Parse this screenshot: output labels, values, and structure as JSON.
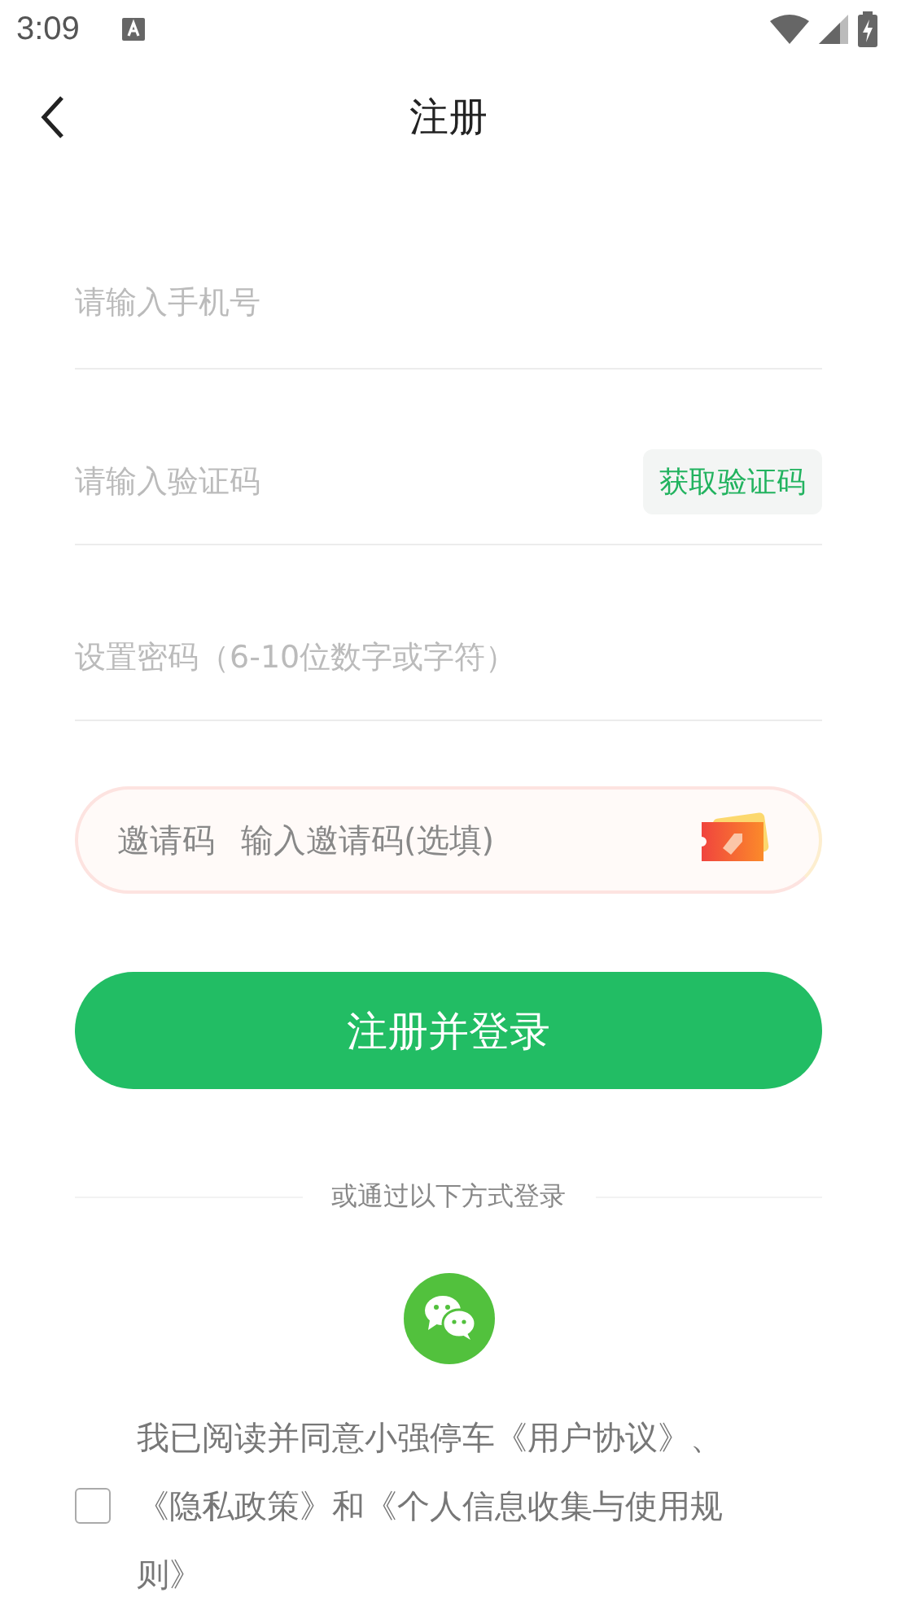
{
  "status_bar": {
    "time": "3:09"
  },
  "header": {
    "title": "注册"
  },
  "fields": [
    {
      "kind": "plain",
      "placeholder": "请输入手机号"
    },
    {
      "kind": "code",
      "placeholder": "请输入验证码",
      "action": "获取验证码"
    },
    {
      "kind": "plain",
      "placeholder": "设置密码（6-10位数字或字符）"
    }
  ],
  "invite": {
    "label": "邀请码",
    "placeholder": "输入邀请码(选填)"
  },
  "submit": "注册并登录",
  "divider_text": "或通过以下方式登录",
  "agreement": {
    "checked": false,
    "text": "我已阅读并同意小强停车《用户协议》、《隐私政策》和《个人信息收集与使用规则》"
  }
}
